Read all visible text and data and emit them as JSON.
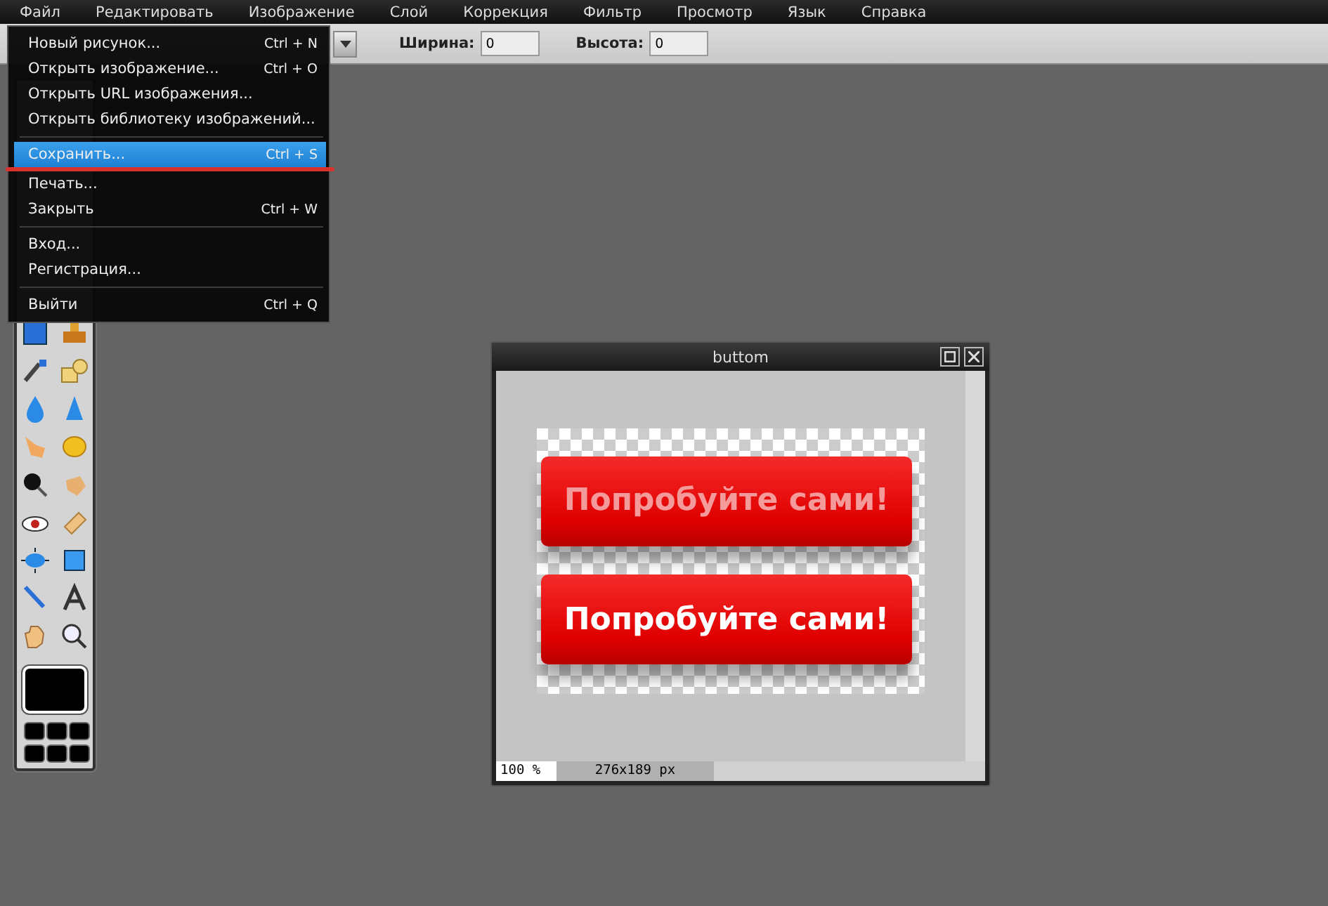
{
  "menubar": [
    {
      "label": "Файл"
    },
    {
      "label": "Редактировать"
    },
    {
      "label": "Изображение"
    },
    {
      "label": "Слой"
    },
    {
      "label": "Коррекция"
    },
    {
      "label": "Фильтр"
    },
    {
      "label": "Просмотр"
    },
    {
      "label": "Язык"
    },
    {
      "label": "Справка"
    }
  ],
  "toolbar": {
    "fields": [
      {
        "label": "Ширина:",
        "value": "0"
      },
      {
        "label": "Высота:",
        "value": "0"
      }
    ]
  },
  "file_menu": {
    "groups": [
      [
        {
          "label": "Новый рисунок...",
          "shortcut": "Ctrl + N",
          "selected": false,
          "marked": false
        },
        {
          "label": "Открыть изображение...",
          "shortcut": "Ctrl + O",
          "selected": false,
          "marked": false
        },
        {
          "label": "Открыть URL изображения...",
          "selected": false,
          "marked": false
        },
        {
          "label": "Открыть библиотеку изображений...",
          "selected": false,
          "marked": false
        }
      ],
      [
        {
          "label": "Сохранить...",
          "shortcut": "Ctrl + S",
          "selected": true,
          "marked": true
        },
        {
          "label": "Печать...",
          "selected": false,
          "marked": false
        },
        {
          "label": "Закрыть",
          "shortcut": "Ctrl + W",
          "selected": false,
          "marked": false
        }
      ],
      [
        {
          "label": "Вход...",
          "selected": false,
          "marked": false
        },
        {
          "label": "Регистрация...",
          "selected": false,
          "marked": false
        }
      ],
      [
        {
          "label": "Выйти",
          "shortcut": "Ctrl + Q",
          "selected": false,
          "marked": false
        }
      ]
    ]
  },
  "image_window": {
    "title": "buttom",
    "image_buttons": [
      {
        "text": "Попробуйте сами!",
        "dimmed": true
      },
      {
        "text": "Попробуйте сами!",
        "dimmed": false
      }
    ],
    "zoom": "100 %",
    "size": "276x189 px"
  }
}
